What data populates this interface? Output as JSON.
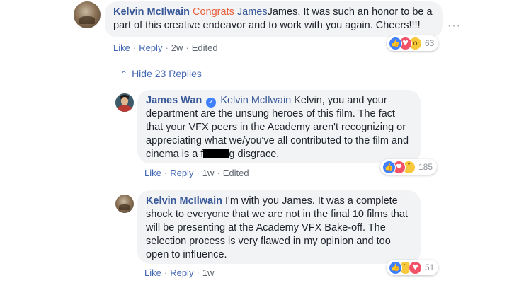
{
  "comment": {
    "author": "Kelvin McIlwain",
    "tag": "Congrats",
    "text": "James, It was such an honor to be a part of this creative endeavor and to work with you again. Cheers!!!!",
    "actions": {
      "like": "Like",
      "reply": "Reply",
      "time": "2w",
      "edited": "Edited"
    },
    "reactions": {
      "icons": [
        "like-icon",
        "love-icon",
        "wow-icon"
      ],
      "count": "63"
    },
    "more_icon": "···"
  },
  "replies_toggle": {
    "chevron": "^",
    "label": "Hide 23 Replies"
  },
  "reply1": {
    "author": "James Wan",
    "verified_icon": "✓",
    "tag": "Kelvin McIlwain",
    "text_before": "Kelvin, you and your department are the unsung heroes of this film. The fact that your VFX peers in the Academy aren't recognizing or appreciating what we/you've all contributed to the film and cinema is a f",
    "text_after": "g disgrace.",
    "actions": {
      "like": "Like",
      "reply": "Reply",
      "time": "1w",
      "edited": "Edited"
    },
    "reactions": {
      "icons": [
        "like-icon",
        "love-icon",
        "sad-icon"
      ],
      "count": "185"
    }
  },
  "reply2": {
    "author": "Kelvin McIlwain",
    "text": "I'm with you James. It was a complete shock to everyone that we are not in the final 10 films that will be presenting at the Academy VFX Bake-off. The selection process is very flawed in my opinion and too open to influence.",
    "actions": {
      "like": "Like",
      "reply": "Reply",
      "time": "1w"
    },
    "reactions": {
      "icons": [
        "like-icon",
        "sad-icon",
        "love-icon"
      ],
      "count": "51"
    }
  }
}
